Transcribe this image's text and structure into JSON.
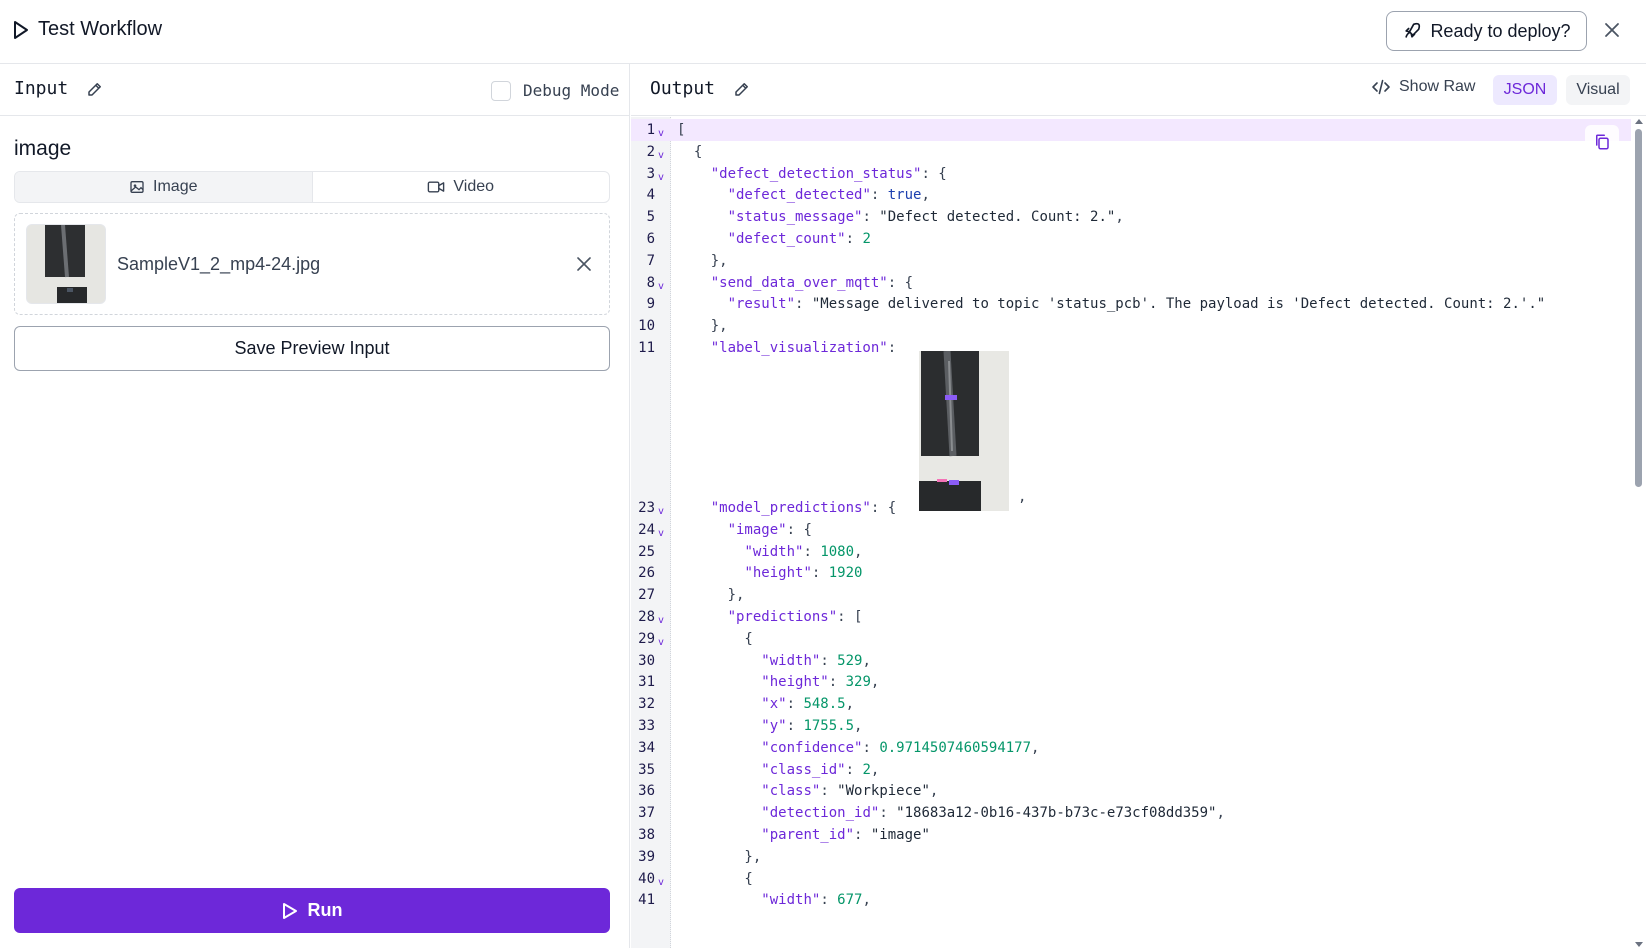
{
  "window": {
    "title": "Test Workflow",
    "deploy_label": "Ready to deploy?"
  },
  "input_panel": {
    "heading": "Input",
    "debug_label": "Debug Mode",
    "debug_checked": false,
    "field_label": "image",
    "media_tabs": [
      {
        "label": "Image",
        "icon": "image-icon",
        "active": true
      },
      {
        "label": "Video",
        "icon": "video-icon",
        "active": false
      }
    ],
    "file": {
      "name": "SampleV1_2_mp4-24.jpg"
    },
    "save_label": "Save Preview Input",
    "run_label": "Run"
  },
  "output_panel": {
    "heading": "Output",
    "show_raw_label": "Show Raw",
    "tabs": [
      {
        "label": "JSON",
        "active": true
      },
      {
        "label": "Visual",
        "active": false
      }
    ],
    "lines": [
      {
        "n": "1",
        "fold": true,
        "hl": true,
        "parts": [
          [
            "p",
            "["
          ]
        ]
      },
      {
        "n": "2",
        "fold": true,
        "parts": [
          [
            "p",
            "  {"
          ]
        ]
      },
      {
        "n": "3",
        "fold": true,
        "parts": [
          [
            "p",
            "    "
          ],
          [
            "k",
            "\"defect_detection_status\""
          ],
          [
            "p",
            ": {"
          ]
        ]
      },
      {
        "n": "4",
        "parts": [
          [
            "p",
            "      "
          ],
          [
            "k",
            "\"defect_detected\""
          ],
          [
            "p",
            ": "
          ],
          [
            "b",
            "true"
          ],
          [
            "p",
            ","
          ]
        ]
      },
      {
        "n": "5",
        "parts": [
          [
            "p",
            "      "
          ],
          [
            "k",
            "\"status_message\""
          ],
          [
            "p",
            ": "
          ],
          [
            "s",
            "\"Defect detected. Count: 2.\""
          ],
          [
            "p",
            ","
          ]
        ]
      },
      {
        "n": "6",
        "parts": [
          [
            "p",
            "      "
          ],
          [
            "k",
            "\"defect_count\""
          ],
          [
            "p",
            ": "
          ],
          [
            "n",
            "2"
          ]
        ]
      },
      {
        "n": "7",
        "parts": [
          [
            "p",
            "    },"
          ]
        ]
      },
      {
        "n": "8",
        "fold": true,
        "parts": [
          [
            "p",
            "    "
          ],
          [
            "k",
            "\"send_data_over_mqtt\""
          ],
          [
            "p",
            ": {"
          ]
        ]
      },
      {
        "n": "9",
        "parts": [
          [
            "p",
            "      "
          ],
          [
            "k",
            "\"result\""
          ],
          [
            "p",
            ": "
          ],
          [
            "s",
            "\"Message delivered to topic 'status_pcb'. The payload is 'Defect detected. Count: 2.'.\""
          ]
        ]
      },
      {
        "n": "10",
        "parts": [
          [
            "p",
            "    },"
          ]
        ]
      },
      {
        "n": "11",
        "parts": [
          [
            "p",
            "    "
          ],
          [
            "k",
            "\"label_visualization\""
          ],
          [
            "p",
            ":"
          ]
        ]
      },
      {
        "n": "23",
        "fold": true,
        "parts": [
          [
            "p",
            "    "
          ],
          [
            "k",
            "\"model_predictions\""
          ],
          [
            "p",
            ": {"
          ]
        ]
      },
      {
        "n": "24",
        "fold": true,
        "parts": [
          [
            "p",
            "      "
          ],
          [
            "k",
            "\"image\""
          ],
          [
            "p",
            ": {"
          ]
        ]
      },
      {
        "n": "25",
        "parts": [
          [
            "p",
            "        "
          ],
          [
            "k",
            "\"width\""
          ],
          [
            "p",
            ": "
          ],
          [
            "n",
            "1080"
          ],
          [
            "p",
            ","
          ]
        ]
      },
      {
        "n": "26",
        "parts": [
          [
            "p",
            "        "
          ],
          [
            "k",
            "\"height\""
          ],
          [
            "p",
            ": "
          ],
          [
            "n",
            "1920"
          ]
        ]
      },
      {
        "n": "27",
        "parts": [
          [
            "p",
            "      },"
          ]
        ]
      },
      {
        "n": "28",
        "fold": true,
        "parts": [
          [
            "p",
            "      "
          ],
          [
            "k",
            "\"predictions\""
          ],
          [
            "p",
            ": ["
          ]
        ]
      },
      {
        "n": "29",
        "fold": true,
        "parts": [
          [
            "p",
            "        {"
          ]
        ]
      },
      {
        "n": "30",
        "parts": [
          [
            "p",
            "          "
          ],
          [
            "k",
            "\"width\""
          ],
          [
            "p",
            ": "
          ],
          [
            "n",
            "529"
          ],
          [
            "p",
            ","
          ]
        ]
      },
      {
        "n": "31",
        "parts": [
          [
            "p",
            "          "
          ],
          [
            "k",
            "\"height\""
          ],
          [
            "p",
            ": "
          ],
          [
            "n",
            "329"
          ],
          [
            "p",
            ","
          ]
        ]
      },
      {
        "n": "32",
        "parts": [
          [
            "p",
            "          "
          ],
          [
            "k",
            "\"x\""
          ],
          [
            "p",
            ": "
          ],
          [
            "n",
            "548.5"
          ],
          [
            "p",
            ","
          ]
        ]
      },
      {
        "n": "33",
        "parts": [
          [
            "p",
            "          "
          ],
          [
            "k",
            "\"y\""
          ],
          [
            "p",
            ": "
          ],
          [
            "n",
            "1755.5"
          ],
          [
            "p",
            ","
          ]
        ]
      },
      {
        "n": "34",
        "parts": [
          [
            "p",
            "          "
          ],
          [
            "k",
            "\"confidence\""
          ],
          [
            "p",
            ": "
          ],
          [
            "n",
            "0.9714507460594177"
          ],
          [
            "p",
            ","
          ]
        ]
      },
      {
        "n": "35",
        "parts": [
          [
            "p",
            "          "
          ],
          [
            "k",
            "\"class_id\""
          ],
          [
            "p",
            ": "
          ],
          [
            "n",
            "2"
          ],
          [
            "p",
            ","
          ]
        ]
      },
      {
        "n": "36",
        "parts": [
          [
            "p",
            "          "
          ],
          [
            "k",
            "\"class\""
          ],
          [
            "p",
            ": "
          ],
          [
            "s",
            "\"Workpiece\""
          ],
          [
            "p",
            ","
          ]
        ]
      },
      {
        "n": "37",
        "parts": [
          [
            "p",
            "          "
          ],
          [
            "k",
            "\"detection_id\""
          ],
          [
            "p",
            ": "
          ],
          [
            "s",
            "\"18683a12-0b16-437b-b73c-e73cf08dd359\""
          ],
          [
            "p",
            ","
          ]
        ]
      },
      {
        "n": "38",
        "parts": [
          [
            "p",
            "          "
          ],
          [
            "k",
            "\"parent_id\""
          ],
          [
            "p",
            ": "
          ],
          [
            "s",
            "\"image\""
          ]
        ]
      },
      {
        "n": "39",
        "parts": [
          [
            "p",
            "        },"
          ]
        ]
      },
      {
        "n": "40",
        "fold": true,
        "parts": [
          [
            "p",
            "        {"
          ]
        ]
      },
      {
        "n": "41",
        "parts": [
          [
            "p",
            "          "
          ],
          [
            "k",
            "\"width\""
          ],
          [
            "p",
            ": "
          ],
          [
            "n",
            "677"
          ],
          [
            "p",
            ","
          ]
        ]
      }
    ],
    "viz_trailing": ","
  },
  "colors": {
    "accent": "#6d28d9",
    "accent_light": "#ede9fe",
    "json_key": "#6d28d9",
    "json_number": "#059669",
    "json_bool": "#1e40af"
  }
}
